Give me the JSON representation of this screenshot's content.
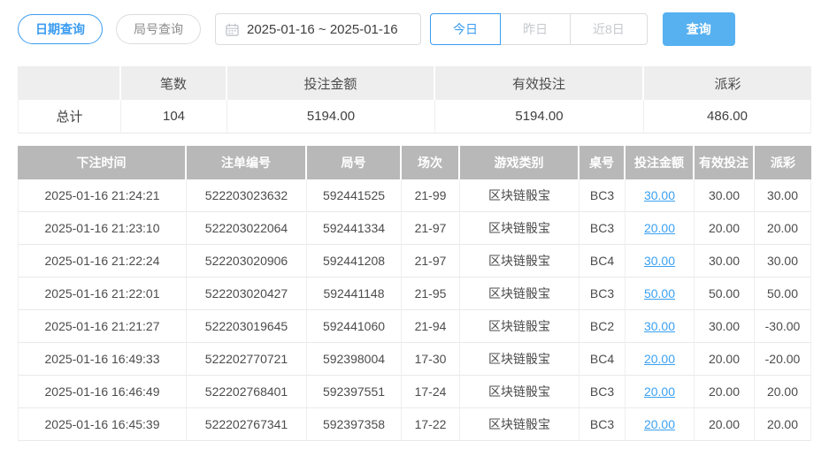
{
  "toolbar": {
    "date_query_label": "日期查询",
    "round_query_label": "局号查询",
    "date_range_value": "2025-01-16 ~ 2025-01-16",
    "today_label": "今日",
    "yesterday_label": "昨日",
    "last8days_label": "近8日",
    "search_label": "查询"
  },
  "summary_table": {
    "headers": [
      "",
      "笔数",
      "投注金额",
      "有效投注",
      "派彩"
    ],
    "row_label": "总计",
    "totals": {
      "count": "104",
      "bet_amount": "5194.00",
      "valid_bet": "5194.00",
      "payout": "486.00"
    }
  },
  "records_table": {
    "headers": [
      "下注时间",
      "注单编号",
      "局号",
      "场次",
      "游戏类别",
      "桌号",
      "投注金额",
      "有效投注",
      "派彩"
    ],
    "rows": [
      {
        "time": "2025-01-16 21:24:21",
        "order_no": "522203023632",
        "round_no": "592441525",
        "session": "21-99",
        "game_type": "区块链骰宝",
        "table_no": "BC3",
        "bet_amount": "30.00",
        "valid_bet": "30.00",
        "payout": "30.00"
      },
      {
        "time": "2025-01-16 21:23:10",
        "order_no": "522203022064",
        "round_no": "592441334",
        "session": "21-97",
        "game_type": "区块链骰宝",
        "table_no": "BC3",
        "bet_amount": "20.00",
        "valid_bet": "20.00",
        "payout": "20.00"
      },
      {
        "time": "2025-01-16 21:22:24",
        "order_no": "522203020906",
        "round_no": "592441208",
        "session": "21-97",
        "game_type": "区块链骰宝",
        "table_no": "BC4",
        "bet_amount": "30.00",
        "valid_bet": "30.00",
        "payout": "30.00"
      },
      {
        "time": "2025-01-16 21:22:01",
        "order_no": "522203020427",
        "round_no": "592441148",
        "session": "21-95",
        "game_type": "区块链骰宝",
        "table_no": "BC3",
        "bet_amount": "50.00",
        "valid_bet": "50.00",
        "payout": "50.00"
      },
      {
        "time": "2025-01-16 21:21:27",
        "order_no": "522203019645",
        "round_no": "592441060",
        "session": "21-94",
        "game_type": "区块链骰宝",
        "table_no": "BC2",
        "bet_amount": "30.00",
        "valid_bet": "30.00",
        "payout": "-30.00"
      },
      {
        "time": "2025-01-16 16:49:33",
        "order_no": "522202770721",
        "round_no": "592398004",
        "session": "17-30",
        "game_type": "区块链骰宝",
        "table_no": "BC4",
        "bet_amount": "20.00",
        "valid_bet": "20.00",
        "payout": "-20.00"
      },
      {
        "time": "2025-01-16 16:46:49",
        "order_no": "522202768401",
        "round_no": "592397551",
        "session": "17-24",
        "game_type": "区块链骰宝",
        "table_no": "BC3",
        "bet_amount": "20.00",
        "valid_bet": "20.00",
        "payout": "20.00"
      },
      {
        "time": "2025-01-16 16:45:39",
        "order_no": "522202767341",
        "round_no": "592397358",
        "session": "17-22",
        "game_type": "区块链骰宝",
        "table_no": "BC3",
        "bet_amount": "20.00",
        "valid_bet": "20.00",
        "payout": "20.00"
      }
    ]
  },
  "colors": {
    "accent_blue": "#3a9cf0",
    "primary_button_blue": "#57b1f0",
    "link_blue": "#3ba1f2",
    "negative_red": "#f56c6c",
    "table_header_gray": "#b8b8b8",
    "summary_header_bg": "#eeeeee"
  }
}
